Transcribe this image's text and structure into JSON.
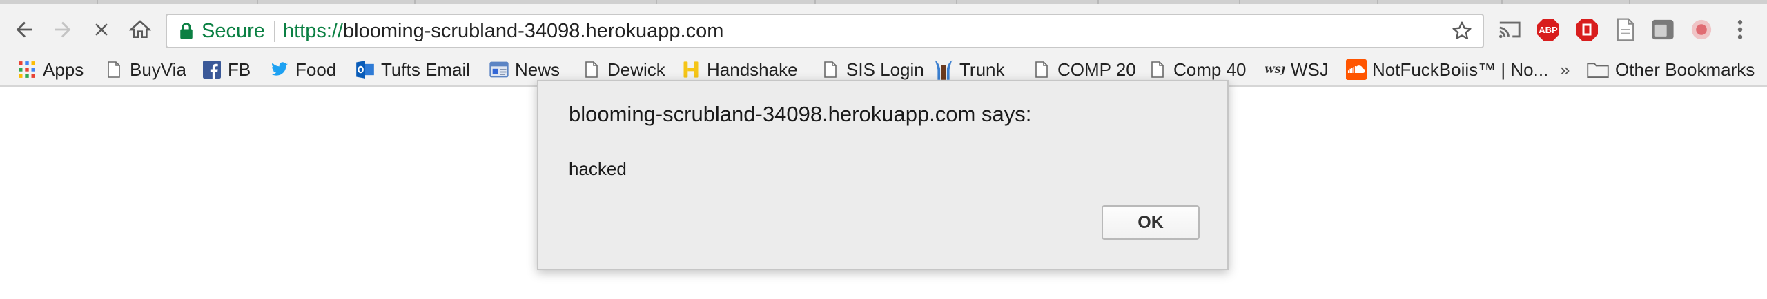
{
  "browser": {
    "security_label": "Secure",
    "url_scheme": "https://",
    "url_host": "blooming-scrubland-34098.herokuapp.com"
  },
  "icons": {
    "back": "back-arrow-icon",
    "forward": "forward-arrow-icon",
    "stop": "stop-icon",
    "home": "home-icon",
    "lock": "lock-icon",
    "star": "star-icon",
    "cast": "cast-icon",
    "adblock": "adblock-icon",
    "opera": "stop-sign-icon",
    "doc": "page-icon",
    "window": "window-icon",
    "record": "record-icon",
    "menu": "more-icon"
  },
  "extensions": {
    "adblock_label": "ABP"
  },
  "bookmarks": [
    {
      "label": "Apps",
      "icon": "apps-grid-icon"
    },
    {
      "label": "BuyVia",
      "icon": "page-icon"
    },
    {
      "label": "FB",
      "icon": "facebook-icon"
    },
    {
      "label": "Food",
      "icon": "twitter-bird-icon"
    },
    {
      "label": "Tufts Email",
      "icon": "outlook-icon"
    },
    {
      "label": "News",
      "icon": "news-icon"
    },
    {
      "label": "Dewick",
      "icon": "page-icon"
    },
    {
      "label": "Handshake",
      "icon": "handshake-icon"
    },
    {
      "label": "SIS Login",
      "icon": "page-icon"
    },
    {
      "label": "Trunk",
      "icon": "trunk-icon"
    },
    {
      "label": "COMP 20",
      "icon": "page-icon"
    },
    {
      "label": "Comp 40",
      "icon": "page-icon"
    },
    {
      "label": "WSJ",
      "icon": "wsj-icon"
    },
    {
      "label": "NotFuckBoiis™ | No...",
      "icon": "soundcloud-icon"
    }
  ],
  "bookmarks_overflow": "»",
  "other_bookmarks": "Other Bookmarks",
  "dialog": {
    "title": "blooming-scrubland-34098.herokuapp.com says:",
    "message": "hacked",
    "ok_label": "OK"
  },
  "colors": {
    "secure_green": "#0b8043",
    "chrome_bg": "#f2f2f2",
    "dialog_bg": "#ececec"
  }
}
